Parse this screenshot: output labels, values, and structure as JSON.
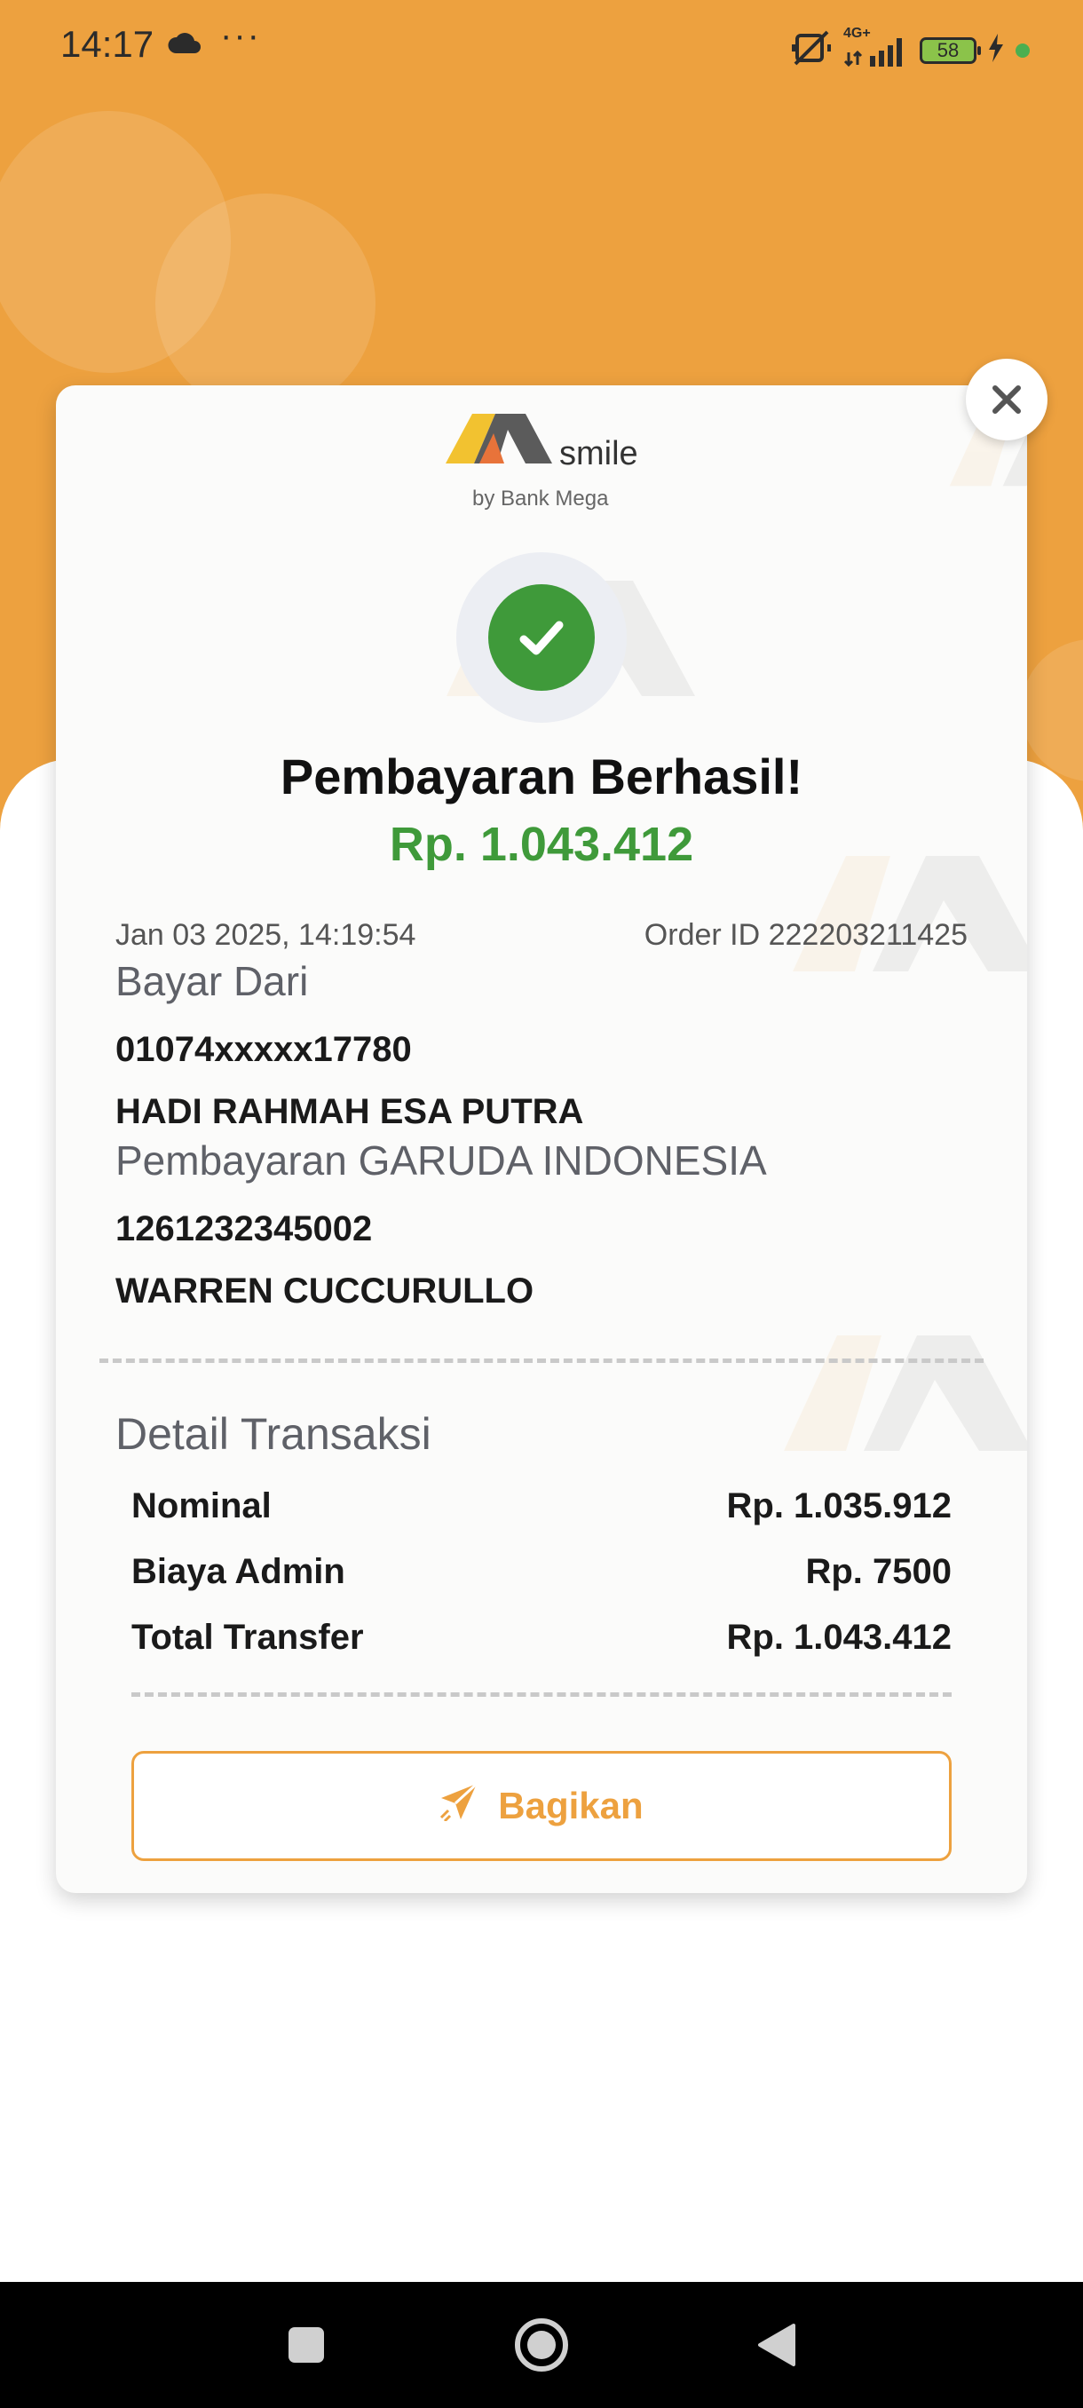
{
  "status_bar": {
    "time": "14:17",
    "more": "···",
    "network": "4G+",
    "battery": "58"
  },
  "brand": {
    "name": "smile",
    "subtitle": "by Bank Mega"
  },
  "receipt": {
    "title": "Pembayaran Berhasil!",
    "amount": "Rp. 1.043.412",
    "date": "Jan 03 2025, 14:19:54",
    "order_id": "Order ID 222203211425",
    "from_label": "Bayar Dari",
    "from_account": "01074xxxxx17780",
    "from_name": "HADI RAHMAH ESA PUTRA",
    "to_label": "Pembayaran GARUDA INDONESIA",
    "to_account": "1261232345002",
    "to_name": "WARREN CUCCURULLO"
  },
  "details": {
    "title": "Detail Transaksi",
    "rows": [
      {
        "label": "Nominal",
        "value": "Rp. 1.035.912"
      },
      {
        "label": "Biaya Admin",
        "value": "Rp. 7500"
      },
      {
        "label": "Total Transfer",
        "value": "Rp. 1.043.412"
      }
    ]
  },
  "actions": {
    "share_label": "Bagikan"
  },
  "colors": {
    "accent": "#EDA13F",
    "success": "#3F9A3A"
  },
  "icons": {
    "close": "close-icon",
    "success": "check-icon",
    "share": "paper-plane-icon"
  }
}
